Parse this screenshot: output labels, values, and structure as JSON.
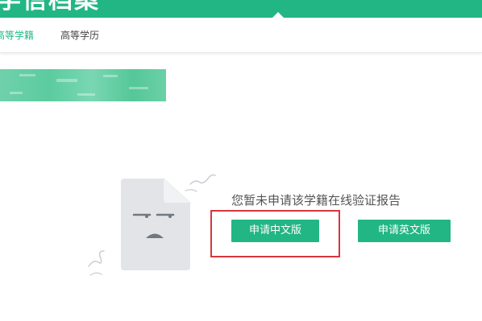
{
  "header": {
    "title": "学信档案",
    "color": "#22b685"
  },
  "tabs": [
    {
      "label": "高等学籍",
      "active": true
    },
    {
      "label": "高等学历",
      "active": false
    }
  ],
  "empty_state": {
    "message": "您暂未申请该学籍在线验证报告",
    "icon": "sad-document-icon"
  },
  "actions": {
    "apply_chinese_label": "申请中文版",
    "apply_english_label": "申请英文版"
  },
  "annotation": {
    "color": "#d9363e"
  }
}
